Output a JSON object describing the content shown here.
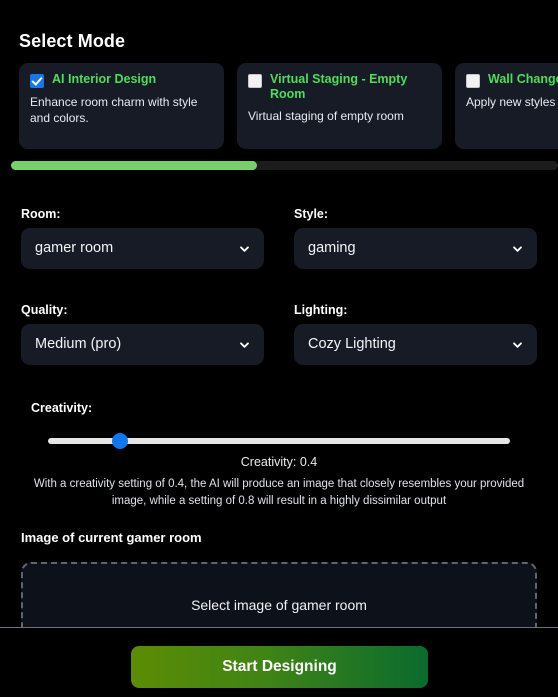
{
  "section": {
    "title": "Select Mode"
  },
  "modes": [
    {
      "title": "AI Interior Design",
      "description": "Enhance room charm with style and colors.",
      "checked": true,
      "checkbox_icon": "checkbox-checked-icon"
    },
    {
      "title": "Virtual Staging - Empty Room",
      "description": "Virtual staging of empty room",
      "checked": false,
      "checkbox_icon": "checkbox-unchecked-icon"
    },
    {
      "title": "Wall Change",
      "description": "Apply new styles and walls",
      "checked": false,
      "checkbox_icon": "checkbox-unchecked-icon"
    }
  ],
  "scrollbar": {
    "thumb_percent": 45
  },
  "fields": {
    "room": {
      "label": "Room:",
      "value": "gamer room"
    },
    "style": {
      "label": "Style:",
      "value": "gaming"
    },
    "quality": {
      "label": "Quality:",
      "value": "Medium (pro)"
    },
    "lighting": {
      "label": "Lighting:",
      "value": "Cozy Lighting"
    }
  },
  "creativity": {
    "label": "Creativity:",
    "value": 0.4,
    "min": 0.3,
    "max": 1,
    "value_text": "Creativity: 0.4",
    "help_text": "With a creativity setting of 0.4, the AI will produce an image that closely resembles your provided image, while a setting of 0.8 will result in a highly dissimilar output"
  },
  "upload": {
    "label": "Image of current gamer room",
    "placeholder": "Select image of gamer room"
  },
  "footer": {
    "submit_label": "Start Designing"
  },
  "colors": {
    "page_background": "#000000",
    "card_background": "#161b26",
    "mode_title_green": "#4ade5a",
    "checkbox_blue": "#1577e8",
    "scroll_thumb_green": "#77d169",
    "slider_blue": "#0d78f2",
    "field_background": "#171b26",
    "button_gradient_start": "#5d8c04",
    "button_gradient_end": "#0a6b2e"
  }
}
